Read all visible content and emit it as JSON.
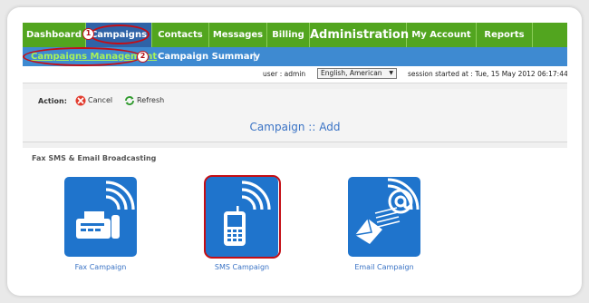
{
  "nav": {
    "items": [
      {
        "label": "Dashboard"
      },
      {
        "label": "Campaigns"
      },
      {
        "label": "Contacts"
      },
      {
        "label": "Messages"
      },
      {
        "label": "Billing"
      },
      {
        "label": "Administration"
      },
      {
        "label": "My Account"
      },
      {
        "label": "Reports"
      }
    ],
    "active": "Campaigns"
  },
  "subnav": {
    "items": [
      {
        "label": "Campaigns Management"
      },
      {
        "label": "Campaign Summary"
      }
    ],
    "separator": "|"
  },
  "callouts": [
    "1",
    "2"
  ],
  "userbar": {
    "user": "user : admin",
    "language": "English, American",
    "session": "session started at : Tue, 15 May 2012 06:17:44 ("
  },
  "actionbar": {
    "label": "Action:",
    "cancel": "Cancel",
    "refresh": "Refresh"
  },
  "page": {
    "title": "Campaign :: Add",
    "section": "Fax SMS & Email Broadcasting"
  },
  "tiles": [
    {
      "label": "Fax Campaign",
      "icon": "fax-machine-icon"
    },
    {
      "label": "SMS Campaign",
      "icon": "mobile-phone-icon"
    },
    {
      "label": "Email Campaign",
      "icon": "email-at-icon"
    }
  ],
  "colors": {
    "nav_green": "#52a51f",
    "active_blue": "#2f63a7",
    "subnav_blue": "#3e8ad1",
    "tile_blue": "#1f74cc",
    "highlight_red": "#c40e15",
    "subnav_active": "#a7f25a"
  }
}
